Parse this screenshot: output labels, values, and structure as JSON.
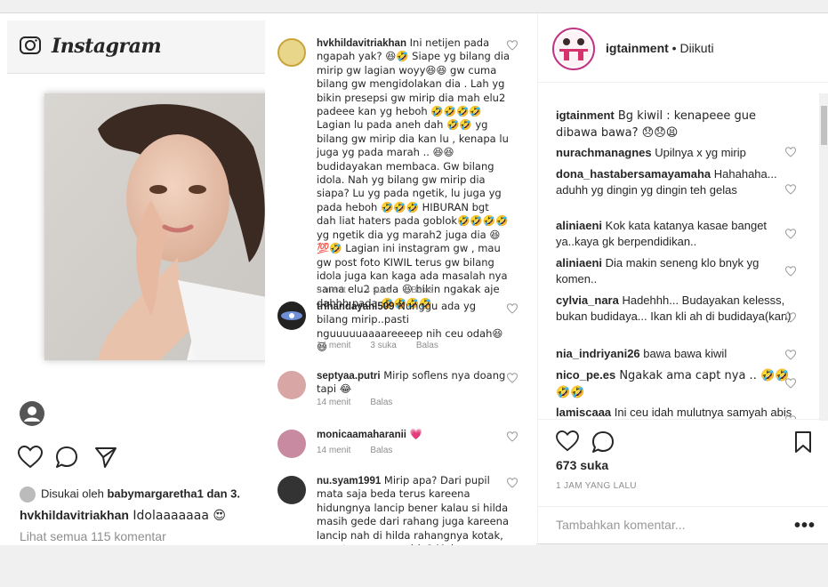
{
  "phone": {
    "app_name": "Instagram",
    "liked_prefix": "Disukai oleh ",
    "liked_user": "babymargaretha1",
    "liked_suffix": " dan 3.",
    "caption_user": "hvkhildavitriakhan",
    "caption_text": " Idolaaaaaaa 😍",
    "view_all": "Lihat semua 115 komentar"
  },
  "image_comments": [
    {
      "user": "hvkhildavitriakhan",
      "text": " Ini netijen pada ngapah yak? 😆🤣 Siape yg bilang dia mirip gw lagian woyy😆😆 gw cuma bilang gw mengidolakan dia . Lah yg bikin presepsi gw mirip dia mah elu2 padeee kan yg heboh 🤣🤣🤣🤣 Lagian lu pada aneh dah 🤣🤣 yg bilang gw mirip dia kan lu , kenapa lu juga yg pada marah .. 😆😆 budidayakan membaca. Gw bilang idola. Nah yg bilang gw mirip dia siapa? Lu yg pada ngetik, lu juga yg pada heboh 🤣🤣🤣 HIBURAN bgt dah liat haters pada goblok🤣🤣🤣🤣 yg ngetik dia yg marah2 juga dia 😆💯🤣 Lagian ini instagram gw , mau gw post foto KIWIL terus gw bilang idola juga kan kaga ada masalah nya sama elu2 pada 😆 bikin ngakak aje dahhh pada 🤣🤣🤣🤣",
      "time": "9 menit",
      "likes": "4 suka",
      "reply": "Balas"
    },
    {
      "user": "trihandayani509",
      "text": " Nunggu ada yg bilang mirip..pasti nguuuuuaaaareeeep nih ceu odah😆😆",
      "time": "14 menit",
      "likes": "3 suka",
      "reply": "Balas"
    },
    {
      "user": "septyaa.putri",
      "text": " Mirip soflens nya doang tapi 😂",
      "time": "14 menit",
      "likes": "",
      "reply": "Balas"
    },
    {
      "user": "monicaamaharanii",
      "text": " 💗",
      "time": "14 menit",
      "likes": "",
      "reply": "Balas"
    },
    {
      "user": "nu.syam1991",
      "text": " Mirip apa? Dari pupil mata saja beda terus kareena hidungnya lancip bener kalau si hilda masih gede dari rahang juga kareena lancip nah di hilda rahangnya kotak, mau tau apa yg mirip? Makeupnya doang yg mirip kala muka sama sekali",
      "time": "",
      "likes": "",
      "reply": ""
    }
  ],
  "side": {
    "account": "igtainment",
    "follow_state": " • Diikuti",
    "comments": [
      {
        "user": "igtainment",
        "text": " Bg kiwil : kenapeee gue dibawa bawa? 😞😞😫"
      },
      {
        "user": "nurachmanagnes",
        "text": " Upilnya x yg mirip"
      },
      {
        "user": "dona_hastabersamayamaha",
        "text": " Hahahaha... aduhh yg dingin yg dingin teh gelas"
      },
      {
        "user": "aliniaeni",
        "text": " Kok kata katanya kasae banget ya..kaya gk berpendidikan.."
      },
      {
        "user": "aliniaeni",
        "text": " Dia makin seneng klo bnyk yg komen.."
      },
      {
        "user": "cylvia_nara",
        "text": " Hadehhh... Budayakan kelesss, bukan budidaya... Ikan kli ah di budidaya(kan)"
      },
      {
        "user": "nia_indriyani26",
        "text": " bawa bawa kiwil"
      },
      {
        "user": "nico_pe.es",
        "text": " Ngakak ama capt nya .. 🤣🤣🤣🤣"
      },
      {
        "user": "lamiscaaa",
        "text": " Ini ceu idah mulutnya samyah abis"
      }
    ],
    "likes": "673 suka",
    "time": "1 JAM YANG LALU",
    "comment_placeholder": "Tambahkan komentar...",
    "more": "•••"
  },
  "colors": {
    "text": "#262626",
    "muted": "#8e8e8e",
    "border": "#efefef",
    "story_ring": "#c13584"
  }
}
